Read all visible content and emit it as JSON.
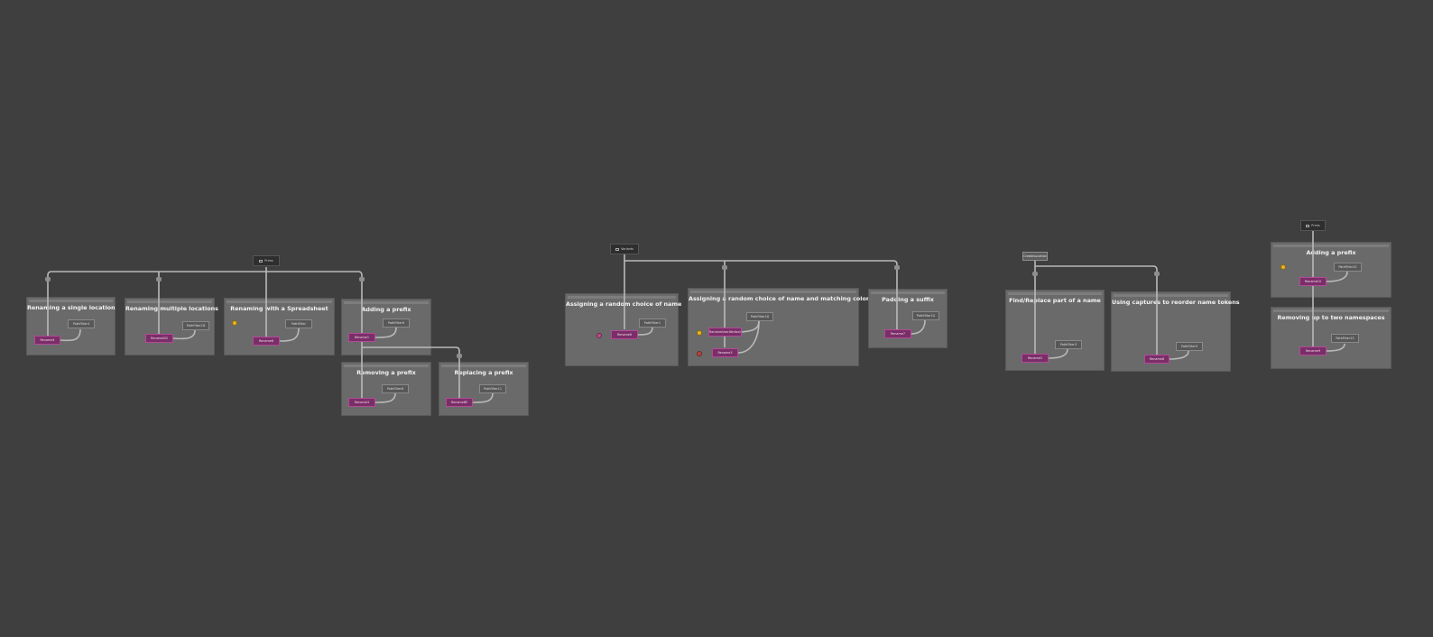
{
  "colors": {
    "background": "#3f3f3f",
    "backdrop": "#6a6a6a",
    "rename_node": "#7a2e67",
    "wire": "#b9b9b9"
  },
  "top_nodes": {
    "a": "Prims",
    "b": "Variants",
    "c": "CreateLocation",
    "d": "Prims"
  },
  "backdrops": {
    "b1": "Renaming a single location",
    "b2": "Renaming multiple locations",
    "b3": "Renaming with a Spreadsheet",
    "b4": "Adding a prefix",
    "b5": "Removing a prefix",
    "b6": "Replacing a prefix",
    "b7": "Assigning a random choice of name",
    "b8": "Assigning a random choice of name and matching color",
    "b9": "Padding a suffix",
    "b10": "Find/Replace part of a name",
    "b11": "Using captures to reorder name tokens",
    "b12": "Adding a prefix",
    "b13": "Removing up to two namespaces"
  },
  "nodes": {
    "r1": "Rename4",
    "u1": "PathFilter4",
    "r2": "Rename2D",
    "u2": "PathFilter2D",
    "r3": "Rename8",
    "u3": "PathFilter",
    "r4": "Rename1",
    "u4": "PathFilter6",
    "r5": "Rename3",
    "u5": "PathFilter8",
    "r6": "Rename8E",
    "u6": "PathFilter11",
    "r7": "Rename6",
    "u7": "PathFilter1",
    "r8a": "RandomUserAttribute",
    "u8": "PathFilter18",
    "r8b": "Rename3",
    "r9": "Rename7",
    "u9": "PathFilter10",
    "r10": "Rename2",
    "u10": "PathFilter3",
    "r11": "Rename8",
    "u11": "PathFilter9",
    "r12": "Rename10",
    "u12": "PathFilter12",
    "r13": "Rename9",
    "u13": "PathFilter13"
  }
}
